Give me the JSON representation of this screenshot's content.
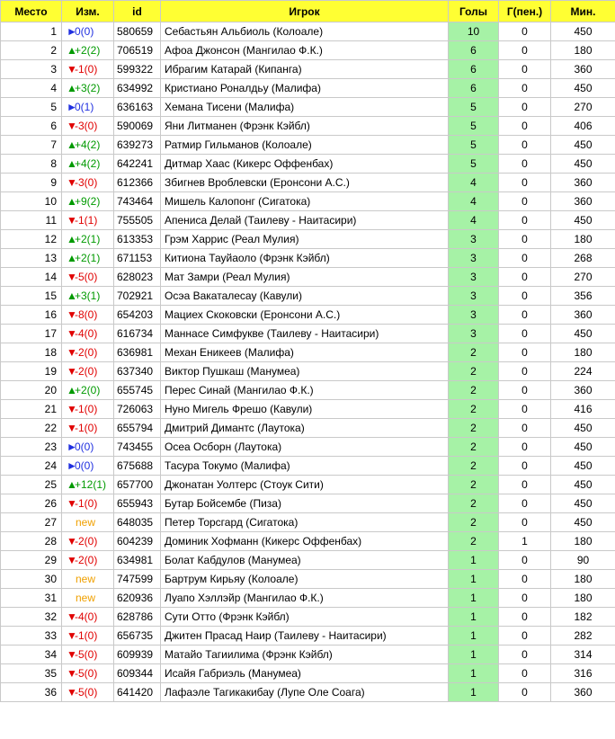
{
  "headers": {
    "place": "Место",
    "change": "Изм.",
    "id": "id",
    "player": "Игрок",
    "goals": "Голы",
    "pen": "Г(пен.)",
    "mins": "Мин."
  },
  "colors": {
    "header_bg": "#ffff33",
    "goals_bg": "#a6f2a6",
    "up": "#009a00",
    "down": "#e00000",
    "same": "#2030e0",
    "new": "#f0a000"
  },
  "rows": [
    {
      "place": "1",
      "dir": "same",
      "arrow": "►",
      "change": "0(0)",
      "id": "580659",
      "player": "Себастьян Альбиоль (Колоале)",
      "goals": "10",
      "pen": "0",
      "mins": "450"
    },
    {
      "place": "2",
      "dir": "up",
      "arrow": "▲",
      "change": "+2(2)",
      "id": "706519",
      "player": "Афоа Джонсон (Мангилао Ф.К.)",
      "goals": "6",
      "pen": "0",
      "mins": "180"
    },
    {
      "place": "3",
      "dir": "down",
      "arrow": "▼",
      "change": "-1(0)",
      "id": "599322",
      "player": "Ибрагим Катарай (Кипанга)",
      "goals": "6",
      "pen": "0",
      "mins": "360"
    },
    {
      "place": "4",
      "dir": "up",
      "arrow": "▲",
      "change": "+3(2)",
      "id": "634992",
      "player": "Кристиано Роналдьу (Малифа)",
      "goals": "6",
      "pen": "0",
      "mins": "450"
    },
    {
      "place": "5",
      "dir": "same",
      "arrow": "►",
      "change": "0(1)",
      "id": "636163",
      "player": "Хемана Тисени (Малифа)",
      "goals": "5",
      "pen": "0",
      "mins": "270"
    },
    {
      "place": "6",
      "dir": "down",
      "arrow": "▼",
      "change": "-3(0)",
      "id": "590069",
      "player": "Яни Литманен (Фрэнк Кэйбл)",
      "goals": "5",
      "pen": "0",
      "mins": "406"
    },
    {
      "place": "7",
      "dir": "up",
      "arrow": "▲",
      "change": "+4(2)",
      "id": "639273",
      "player": "Ратмир Гильманов (Колоале)",
      "goals": "5",
      "pen": "0",
      "mins": "450"
    },
    {
      "place": "8",
      "dir": "up",
      "arrow": "▲",
      "change": "+4(2)",
      "id": "642241",
      "player": "Дитмар Хаас (Кикерс Оффенбах)",
      "goals": "5",
      "pen": "0",
      "mins": "450"
    },
    {
      "place": "9",
      "dir": "down",
      "arrow": "▼",
      "change": "-3(0)",
      "id": "612366",
      "player": "Збигнев Вроблевски (Еронсони А.С.)",
      "goals": "4",
      "pen": "0",
      "mins": "360"
    },
    {
      "place": "10",
      "dir": "up",
      "arrow": "▲",
      "change": "+9(2)",
      "id": "743464",
      "player": "Мишель Калопонг (Сигатока)",
      "goals": "4",
      "pen": "0",
      "mins": "360"
    },
    {
      "place": "11",
      "dir": "down",
      "arrow": "▼",
      "change": "-1(1)",
      "id": "755505",
      "player": "Апениса Делай (Таилеву - Наитасири)",
      "goals": "4",
      "pen": "0",
      "mins": "450"
    },
    {
      "place": "12",
      "dir": "up",
      "arrow": "▲",
      "change": "+2(1)",
      "id": "613353",
      "player": "Грэм Харрис (Реал Мулия)",
      "goals": "3",
      "pen": "0",
      "mins": "180"
    },
    {
      "place": "13",
      "dir": "up",
      "arrow": "▲",
      "change": "+2(1)",
      "id": "671153",
      "player": "Китиона Тауйаоло (Фрэнк Кэйбл)",
      "goals": "3",
      "pen": "0",
      "mins": "268"
    },
    {
      "place": "14",
      "dir": "down",
      "arrow": "▼",
      "change": "-5(0)",
      "id": "628023",
      "player": "Мат Замри (Реал Мулия)",
      "goals": "3",
      "pen": "0",
      "mins": "270"
    },
    {
      "place": "15",
      "dir": "up",
      "arrow": "▲",
      "change": "+3(1)",
      "id": "702921",
      "player": "Осэа Вакаталесау (Кавули)",
      "goals": "3",
      "pen": "0",
      "mins": "356"
    },
    {
      "place": "16",
      "dir": "down",
      "arrow": "▼",
      "change": "-8(0)",
      "id": "654203",
      "player": "Мациех Скоковски (Еронсони А.С.)",
      "goals": "3",
      "pen": "0",
      "mins": "360"
    },
    {
      "place": "17",
      "dir": "down",
      "arrow": "▼",
      "change": "-4(0)",
      "id": "616734",
      "player": "Маннасе Симфукве (Таилеву - Наитасири)",
      "goals": "3",
      "pen": "0",
      "mins": "450"
    },
    {
      "place": "18",
      "dir": "down",
      "arrow": "▼",
      "change": "-2(0)",
      "id": "636981",
      "player": "Механ Еникеев (Малифа)",
      "goals": "2",
      "pen": "0",
      "mins": "180"
    },
    {
      "place": "19",
      "dir": "down",
      "arrow": "▼",
      "change": "-2(0)",
      "id": "637340",
      "player": "Виктор Пушкаш (Манумеа)",
      "goals": "2",
      "pen": "0",
      "mins": "224"
    },
    {
      "place": "20",
      "dir": "up",
      "arrow": "▲",
      "change": "+2(0)",
      "id": "655745",
      "player": "Перес Синай (Мангилао Ф.К.)",
      "goals": "2",
      "pen": "0",
      "mins": "360"
    },
    {
      "place": "21",
      "dir": "down",
      "arrow": "▼",
      "change": "-1(0)",
      "id": "726063",
      "player": "Нуно Мигель Фрешо (Кавули)",
      "goals": "2",
      "pen": "0",
      "mins": "416"
    },
    {
      "place": "22",
      "dir": "down",
      "arrow": "▼",
      "change": "-1(0)",
      "id": "655794",
      "player": "Дмитрий Димантс (Лаутока)",
      "goals": "2",
      "pen": "0",
      "mins": "450"
    },
    {
      "place": "23",
      "dir": "same",
      "arrow": "►",
      "change": "0(0)",
      "id": "743455",
      "player": "Осеа Осборн (Лаутока)",
      "goals": "2",
      "pen": "0",
      "mins": "450"
    },
    {
      "place": "24",
      "dir": "same",
      "arrow": "►",
      "change": "0(0)",
      "id": "675688",
      "player": "Тасура Токумо (Малифа)",
      "goals": "2",
      "pen": "0",
      "mins": "450"
    },
    {
      "place": "25",
      "dir": "up",
      "arrow": "▲",
      "change": "+12(1)",
      "id": "657700",
      "player": "Джонатан Уолтерс (Стоук Сити)",
      "goals": "2",
      "pen": "0",
      "mins": "450"
    },
    {
      "place": "26",
      "dir": "down",
      "arrow": "▼",
      "change": "-1(0)",
      "id": "655943",
      "player": "Бутар Бойсембе (Пиза)",
      "goals": "2",
      "pen": "0",
      "mins": "450"
    },
    {
      "place": "27",
      "dir": "new",
      "arrow": "",
      "change": "new",
      "id": "648035",
      "player": "Петер Торсгард (Сигатока)",
      "goals": "2",
      "pen": "0",
      "mins": "450"
    },
    {
      "place": "28",
      "dir": "down",
      "arrow": "▼",
      "change": "-2(0)",
      "id": "604239",
      "player": "Доминик Хофманн (Кикерс Оффенбах)",
      "goals": "2",
      "pen": "1",
      "mins": "180"
    },
    {
      "place": "29",
      "dir": "down",
      "arrow": "▼",
      "change": "-2(0)",
      "id": "634981",
      "player": "Болат Кабдулов (Манумеа)",
      "goals": "1",
      "pen": "0",
      "mins": "90"
    },
    {
      "place": "30",
      "dir": "new",
      "arrow": "",
      "change": "new",
      "id": "747599",
      "player": "Бартрум Кирьяу (Колоале)",
      "goals": "1",
      "pen": "0",
      "mins": "180"
    },
    {
      "place": "31",
      "dir": "new",
      "arrow": "",
      "change": "new",
      "id": "620936",
      "player": "Луапо Хэллэйр (Мангилао Ф.К.)",
      "goals": "1",
      "pen": "0",
      "mins": "180"
    },
    {
      "place": "32",
      "dir": "down",
      "arrow": "▼",
      "change": "-4(0)",
      "id": "628786",
      "player": "Сути Отто (Фрэнк Кэйбл)",
      "goals": "1",
      "pen": "0",
      "mins": "182"
    },
    {
      "place": "33",
      "dir": "down",
      "arrow": "▼",
      "change": "-1(0)",
      "id": "656735",
      "player": "Джитен Прасад Наир (Таилеву - Наитасири)",
      "goals": "1",
      "pen": "0",
      "mins": "282"
    },
    {
      "place": "34",
      "dir": "down",
      "arrow": "▼",
      "change": "-5(0)",
      "id": "609939",
      "player": "Матайо Тагиилима (Фрэнк Кэйбл)",
      "goals": "1",
      "pen": "0",
      "mins": "314"
    },
    {
      "place": "35",
      "dir": "down",
      "arrow": "▼",
      "change": "-5(0)",
      "id": "609344",
      "player": "Исайя Габриэль (Манумеа)",
      "goals": "1",
      "pen": "0",
      "mins": "316"
    },
    {
      "place": "36",
      "dir": "down",
      "arrow": "▼",
      "change": "-5(0)",
      "id": "641420",
      "player": "Лафаэле Тагикакибау (Лупе Оле Соага)",
      "goals": "1",
      "pen": "0",
      "mins": "360"
    }
  ]
}
